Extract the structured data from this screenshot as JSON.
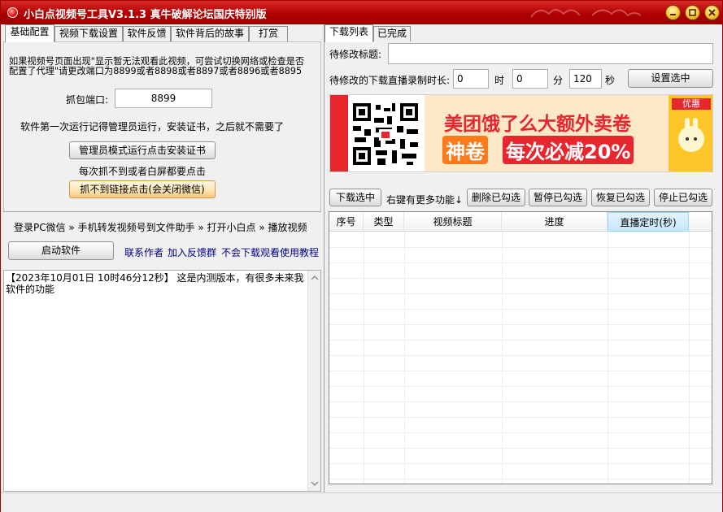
{
  "window": {
    "title": "小白点视频号工具V3.1.3 真牛破解论坛国庆特别版"
  },
  "left_tabs": [
    {
      "label": "基础配置",
      "active": true
    },
    {
      "label": "视频下载设置",
      "active": false
    },
    {
      "label": "软件反馈",
      "active": false
    },
    {
      "label": "软件背后的故事",
      "active": false
    },
    {
      "label": "打赏",
      "active": false
    }
  ],
  "config": {
    "notice": "如果视频号页面出现\"显示暂无法观看此视频，可尝试切换网络或检查是否配置了代理\"请更改端口为8899或者8898或者8897或者8896或者8895",
    "port_label": "抓包端口:",
    "port_value": "8899",
    "admin_notice": "软件第一次运行记得管理员运行，安装证书，之后就不需要了",
    "admin_button": "管理员模式运行点击安装证书",
    "refresh_notice": "每次抓不到或者白屏都要点击",
    "capture_button": "抓不到链接点击(会关闭微信)"
  },
  "steps": {
    "text": "登录PC微信 » 手机转发视频号到文件助手 » 打开小白点 » 播放视频"
  },
  "actions": {
    "start_button": "启动软件",
    "contact_link": "联系作者",
    "group_link": "加入反馈群",
    "tutorial_link": "不会下载观看使用教程"
  },
  "log": {
    "text": "【2023年10月01日 10时46分12秒】 这是内测版本，有很多未来我软件的功能"
  },
  "right_tabs": [
    {
      "label": "下载列表",
      "active": true
    },
    {
      "label": "已完成",
      "active": false
    }
  ],
  "edit": {
    "title_label": "待修改标题:",
    "title_value": "",
    "duration_label": "待修改的下载直播录制时长:",
    "hours": "0",
    "hours_unit": "时",
    "minutes": "0",
    "minutes_unit": "分",
    "seconds": "120",
    "seconds_unit": "秒",
    "set_button": "设置选中"
  },
  "ad": {
    "headline": "美团饿了么大额外卖卷",
    "highlight": "神卷",
    "slogan": "每次必减20%",
    "badge": "优惠"
  },
  "toolbar": {
    "download_button": "下载选中",
    "hint": "右键有更多功能↓",
    "delete_button": "删除已勾选",
    "pause_button": "暂停已勾选",
    "resume_button": "恢复已勾选",
    "stop_button": "停止已勾选"
  },
  "table": {
    "columns": [
      "序号",
      "类型",
      "视频标题",
      "进度",
      "直播定时(秒)"
    ],
    "rows": []
  },
  "colors": {
    "title_bar": "#b00000",
    "ad_red": "#e8262d",
    "ad_orange": "#ff7a1a",
    "link": "#00008b"
  }
}
